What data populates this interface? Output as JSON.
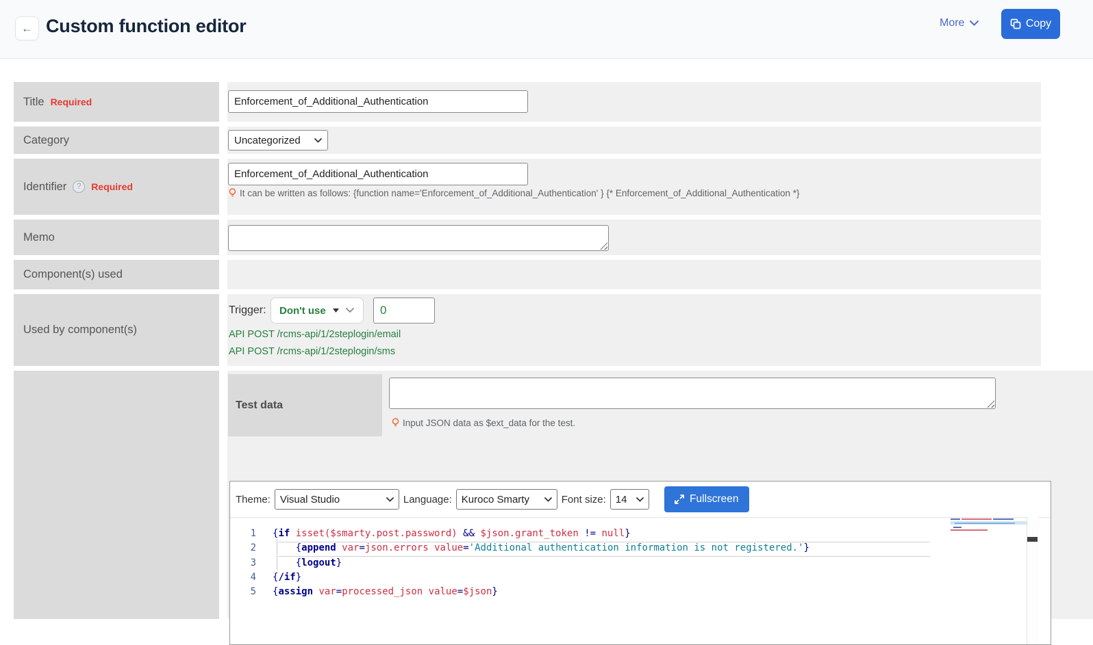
{
  "header": {
    "back_label": "←",
    "title": "Custom function editor",
    "more_label": "More",
    "copy_label": "Copy"
  },
  "form": {
    "rows": {
      "title": {
        "label": "Title",
        "required": "Required",
        "value": "Enforcement_of_Additional_Authentication"
      },
      "category": {
        "label": "Category",
        "value": "Uncategorized"
      },
      "identifier": {
        "label": "Identifier",
        "help": "?",
        "required": "Required",
        "value": "Enforcement_of_Additional_Authentication",
        "hint": "It can be written as follows: {function name='Enforcement_of_Additional_Authentication' } {* Enforcement_of_Additional_Authentication *}"
      },
      "memo": {
        "label": "Memo"
      },
      "components_used": {
        "label": "Component(s) used"
      },
      "used_by": {
        "label": "Used by component(s)",
        "trigger_label": "Trigger:",
        "trigger_value": "Don't use",
        "trigger_count": "0",
        "links": [
          "API POST /rcms-api/1/2steplogin/email",
          "API POST /rcms-api/1/2steplogin/sms"
        ]
      },
      "test_data": {
        "label": "Test data",
        "hint": "Input JSON data as $ext_data for the test."
      }
    }
  },
  "editor": {
    "theme_label": "Theme:",
    "theme_value": "Visual Studio",
    "language_label": "Language:",
    "language_value": "Kuroco Smarty",
    "font_size_label": "Font size:",
    "font_size_value": "14",
    "fullscreen_label": "Fullscreen",
    "lines": [
      {
        "n": "1",
        "t": [
          [
            "p",
            "{"
          ],
          [
            "k",
            "if"
          ],
          [
            "t",
            " "
          ],
          [
            "i",
            "isset($smarty.post.password)"
          ],
          [
            "p",
            " && "
          ],
          [
            "i",
            "$json.grant_token"
          ],
          [
            "p",
            " != "
          ],
          [
            "i",
            "null"
          ],
          [
            "p",
            "}"
          ]
        ]
      },
      {
        "n": "2",
        "t": [
          [
            "t",
            "    "
          ],
          [
            "p",
            "{"
          ],
          [
            "k",
            "append"
          ],
          [
            "t",
            " "
          ],
          [
            "i",
            "var"
          ],
          [
            "p",
            "="
          ],
          [
            "i",
            "json.errors"
          ],
          [
            "t",
            " "
          ],
          [
            "i",
            "value"
          ],
          [
            "p",
            "="
          ],
          [
            "s",
            "'Additional authentication information is not registered.'"
          ],
          [
            "p",
            "}"
          ]
        ]
      },
      {
        "n": "3",
        "t": [
          [
            "t",
            "    "
          ],
          [
            "p",
            "{"
          ],
          [
            "k",
            "logout"
          ],
          [
            "p",
            "}"
          ]
        ]
      },
      {
        "n": "4",
        "t": [
          [
            "p",
            "{"
          ],
          [
            "k",
            "/if"
          ],
          [
            "p",
            "}"
          ]
        ]
      },
      {
        "n": "5",
        "t": [
          [
            "p",
            "{"
          ],
          [
            "k",
            "assign"
          ],
          [
            "t",
            " "
          ],
          [
            "i",
            "var"
          ],
          [
            "p",
            "="
          ],
          [
            "i",
            "processed_json"
          ],
          [
            "t",
            " "
          ],
          [
            "i",
            "value"
          ],
          [
            "p",
            "="
          ],
          [
            "i",
            "$json"
          ],
          [
            "p",
            "}"
          ]
        ]
      }
    ]
  },
  "colors": {
    "accent": "#2a6cd9",
    "accent_soft": "#4b6bce",
    "green": "#27803f",
    "required": "#e8382e",
    "bulb": "#f06a33",
    "kw": "#00008b",
    "ident": "#cc2f44",
    "str": "#0e7f95"
  }
}
